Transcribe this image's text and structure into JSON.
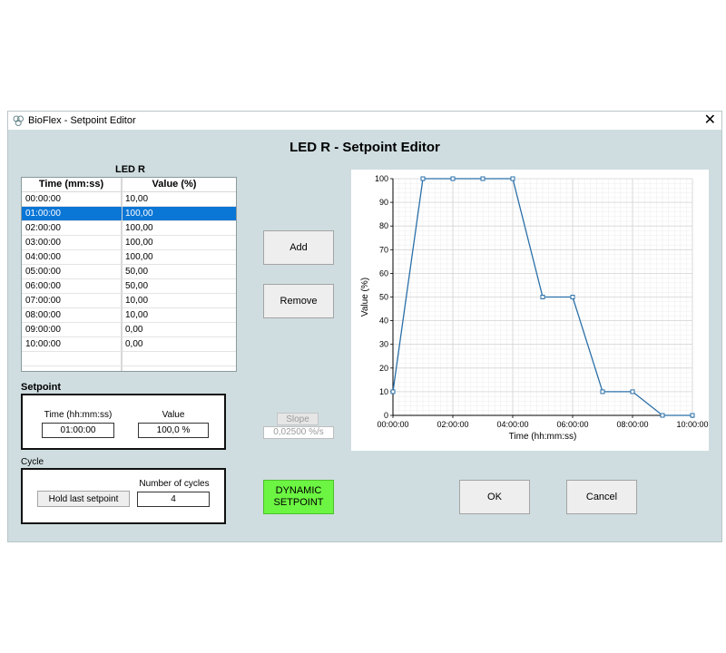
{
  "window": {
    "title": "BioFlex - Setpoint Editor",
    "close_glyph": "✕"
  },
  "editor_title": "LED R - Setpoint Editor",
  "table": {
    "title": "LED R",
    "columns": [
      "Time (mm:ss)",
      "Value (%)"
    ],
    "rows": [
      [
        "00:00:00",
        "10,00"
      ],
      [
        "01:00:00",
        "100,00"
      ],
      [
        "02:00:00",
        "100,00"
      ],
      [
        "03:00:00",
        "100,00"
      ],
      [
        "04:00:00",
        "100,00"
      ],
      [
        "05:00:00",
        "50,00"
      ],
      [
        "06:00:00",
        "50,00"
      ],
      [
        "07:00:00",
        "10,00"
      ],
      [
        "08:00:00",
        "10,00"
      ],
      [
        "09:00:00",
        "0,00"
      ],
      [
        "10:00:00",
        "0,00"
      ]
    ],
    "selected_row": 1
  },
  "setpoint": {
    "title": "Setpoint",
    "time_label": "Time (hh:mm:ss)",
    "time_value": "01:00:00",
    "value_label": "Value",
    "value_value": "100,0 %"
  },
  "cycle": {
    "title": "Cycle",
    "hold_label": "Hold last setpoint",
    "cycles_label": "Number of cycles",
    "cycles_value": "4"
  },
  "buttons": {
    "add": "Add",
    "remove": "Remove",
    "slope": "Slope",
    "slope_value": "0,02500 %/s",
    "dynamic_line1": "DYNAMIC",
    "dynamic_line2": "SETPOINT",
    "ok": "OK",
    "cancel": "Cancel"
  },
  "colors": {
    "window_bg": "#cfdde0",
    "selection": "#0a76d6",
    "dynamic_button": "#6cf542",
    "series_line": "#2a6fa8"
  },
  "chart_data": {
    "type": "line",
    "xlabel": "Time (hh:mm:ss)",
    "ylabel": "Value (%)",
    "x": [
      0,
      1,
      2,
      3,
      4,
      5,
      6,
      7,
      8,
      9,
      10
    ],
    "x_unit": "hours",
    "xlim": [
      0,
      10
    ],
    "xticks": [
      "00:00:00",
      "02:00:00",
      "04:00:00",
      "06:00:00",
      "08:00:00",
      "10:00:00"
    ],
    "ylim": [
      0,
      100
    ],
    "yticks": [
      "0",
      "10",
      "20",
      "30",
      "40",
      "50",
      "60",
      "70",
      "80",
      "90",
      "100"
    ],
    "series": [
      {
        "values": [
          10,
          100,
          100,
          100,
          100,
          50,
          50,
          10,
          10,
          0,
          0
        ]
      }
    ],
    "grid": true
  }
}
